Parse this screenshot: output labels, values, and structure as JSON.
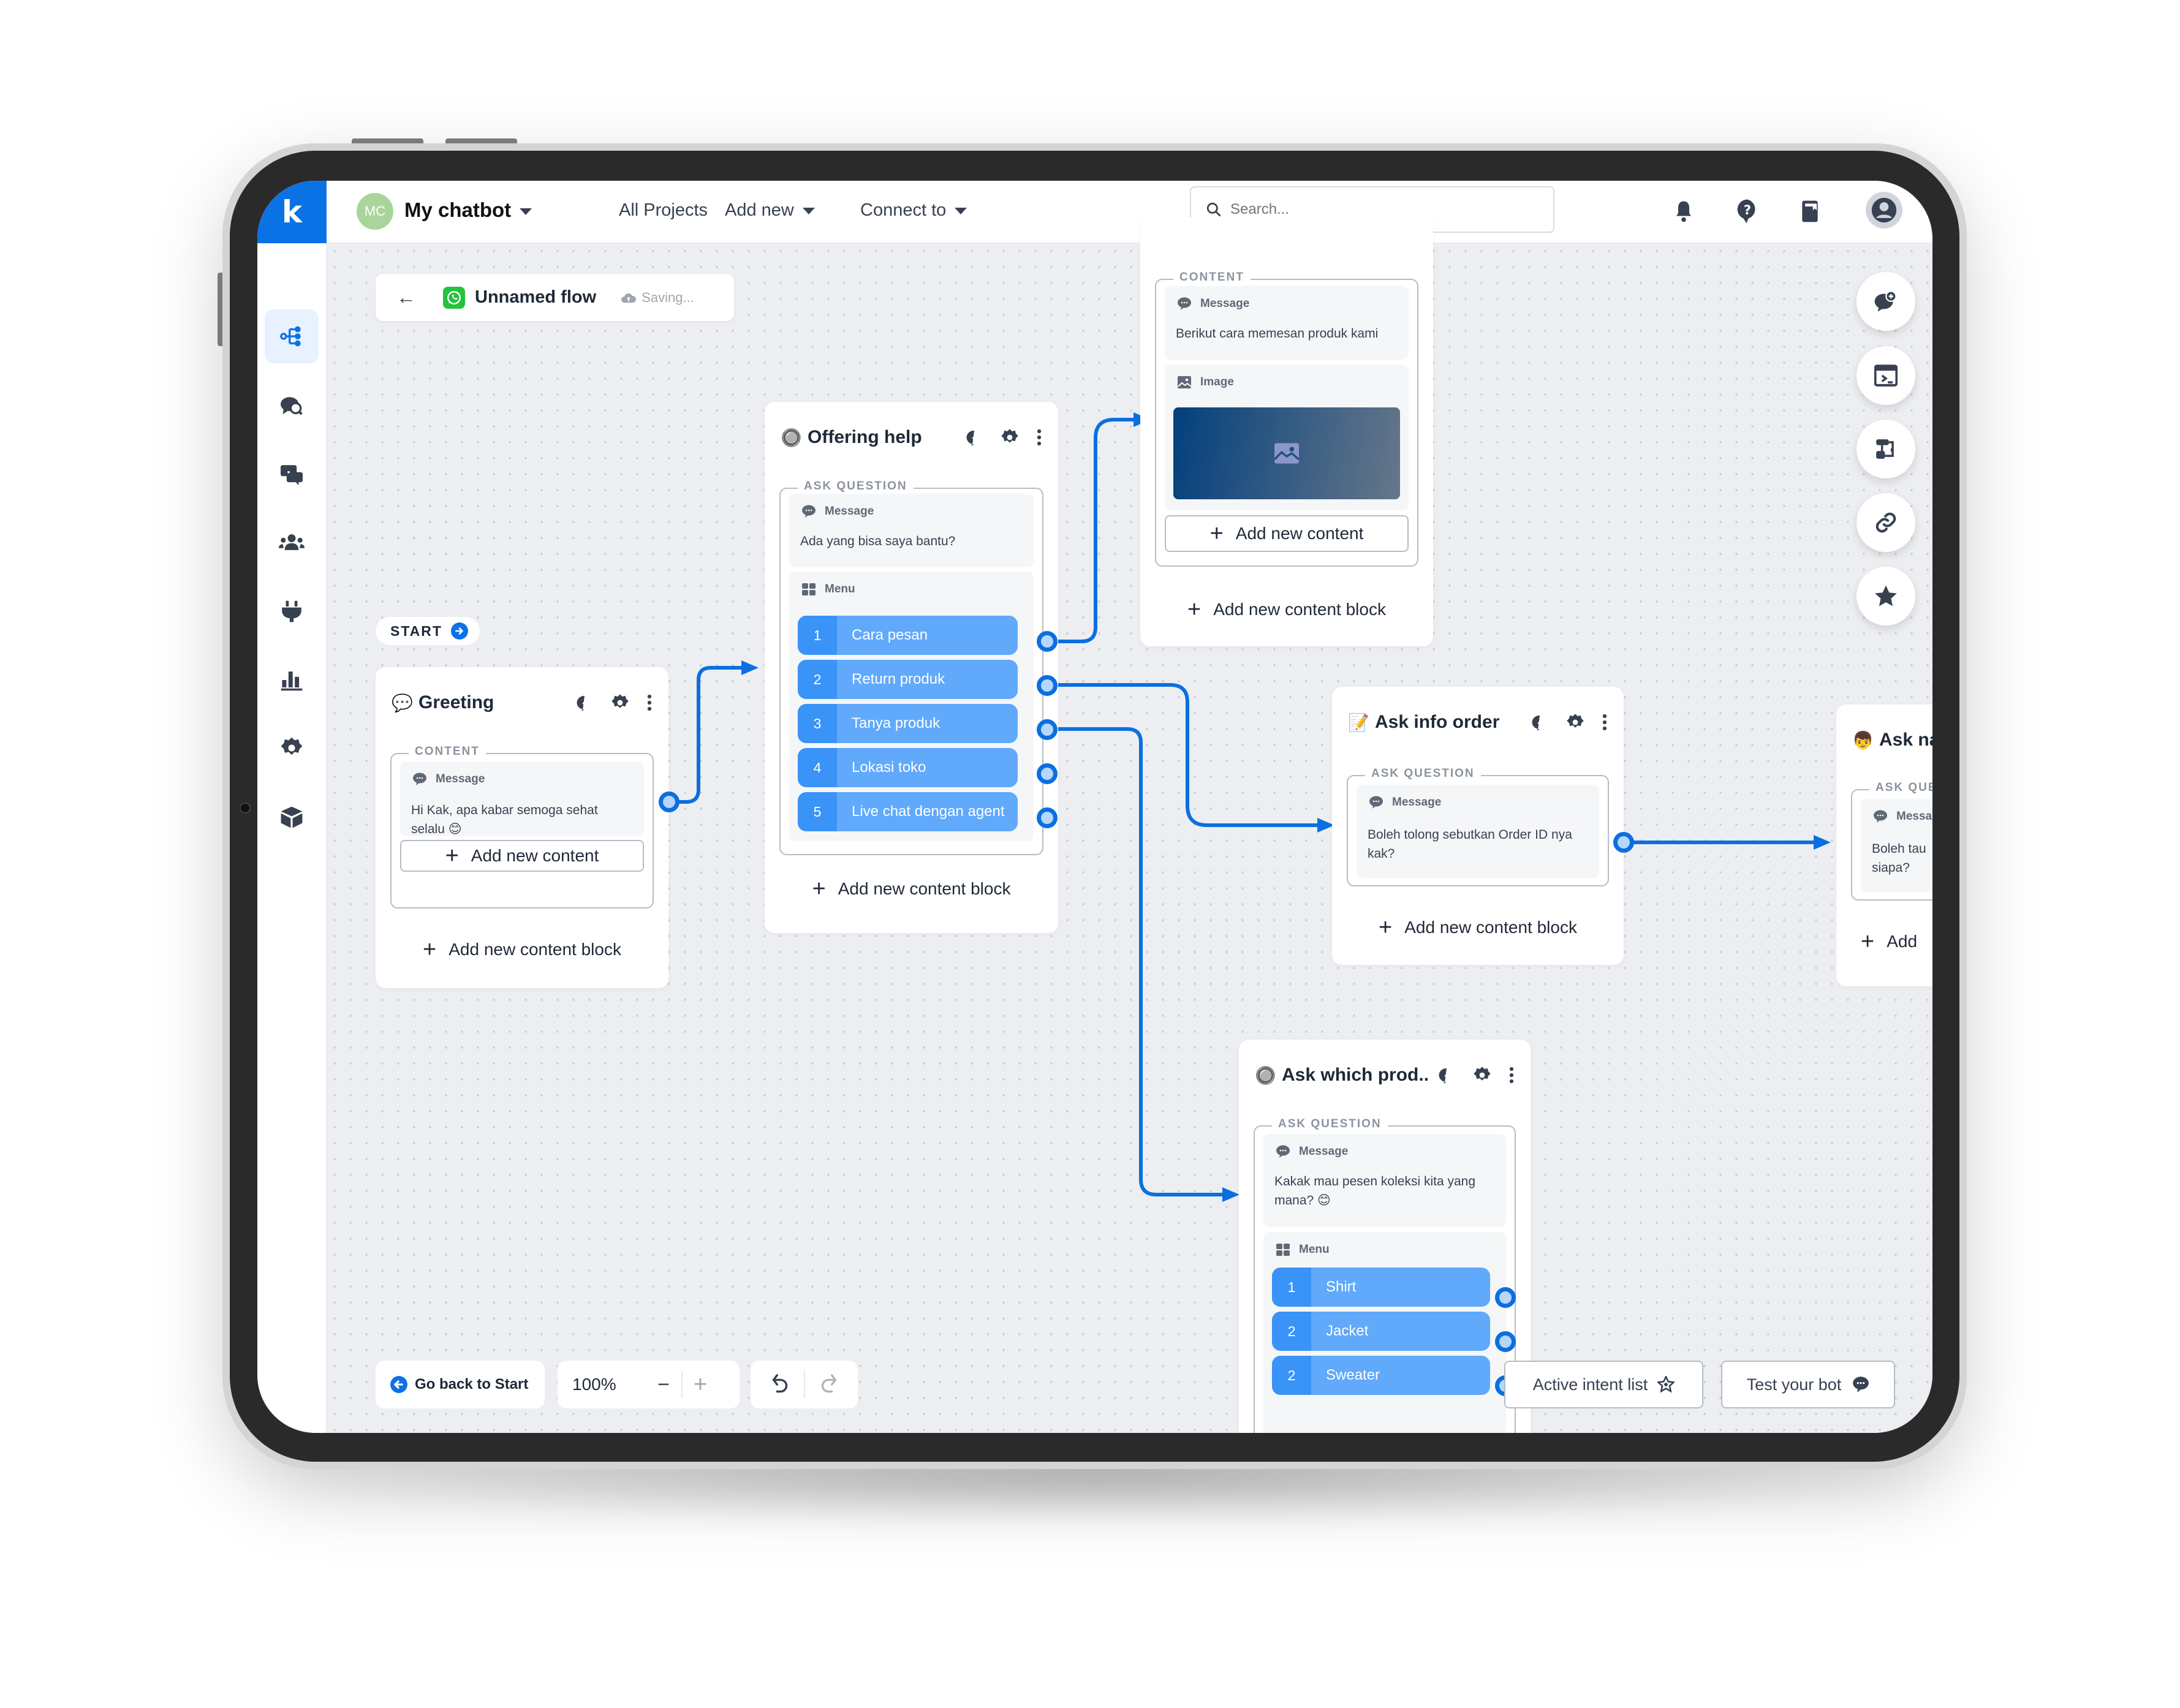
{
  "header": {
    "logo_glyph": "k",
    "bot_avatar_initials": "MC",
    "bot_name": "My chatbot",
    "nav": [
      {
        "label": "All Projects"
      },
      {
        "label": "Add new"
      },
      {
        "label": "Connect to"
      }
    ],
    "search": {
      "value": "",
      "placeholder": "Search..."
    },
    "icons": [
      "bell-icon",
      "help-icon",
      "book-icon",
      "user-avatar"
    ]
  },
  "sidebar": {
    "items": [
      {
        "icon": "flow-icon",
        "active": true
      },
      {
        "icon": "chat-search-icon",
        "active": false
      },
      {
        "icon": "conversations-icon",
        "active": false
      },
      {
        "icon": "users-icon",
        "active": false
      },
      {
        "icon": "plug-icon",
        "active": false
      },
      {
        "icon": "analytics-icon",
        "active": false
      },
      {
        "icon": "settings-icon",
        "active": false
      },
      {
        "icon": "box-icon",
        "active": false
      }
    ]
  },
  "flow": {
    "back_glyph": "←",
    "name": "Unnamed flow",
    "status": "Saving..."
  },
  "start_label": "START",
  "common": {
    "add_new_content": "Add new content",
    "add_new_content_block": "Add new content block",
    "message_label": "Message",
    "menu_label": "Menu",
    "image_label": "Image",
    "content_label": "CONTENT",
    "ask_question_label": "ASK QUESTION"
  },
  "nodes": {
    "greeting": {
      "emoji": "💬",
      "title": "Greeting",
      "section": "CONTENT",
      "message": "Hi Kak, apa kabar semoga sehat selalu 😊"
    },
    "offering_help": {
      "emoji": "🔘",
      "title": "Offering help",
      "section": "ASK QUESTION",
      "message": "Ada yang bisa saya bantu?",
      "menu": [
        {
          "num": "1",
          "label": "Cara pesan"
        },
        {
          "num": "2",
          "label": "Return produk"
        },
        {
          "num": "3",
          "label": "Tanya produk"
        },
        {
          "num": "4",
          "label": "Lokasi toko"
        },
        {
          "num": "5",
          "label": "Live chat dengan agent"
        }
      ]
    },
    "cara_pesan": {
      "section": "CONTENT",
      "message": "Berikut cara memesan produk kami",
      "image_label": "Image"
    },
    "ask_info_order": {
      "emoji": "📝",
      "title": "Ask info order",
      "section": "ASK QUESTION",
      "message": "Boleh tolong sebutkan Order ID nya kak?"
    },
    "ask_name": {
      "emoji": "👦",
      "title": "Ask na",
      "section": "ASK QUE",
      "message_label": "Messa",
      "message": "Boleh tau siapa?",
      "add_block": "Add"
    },
    "ask_which_product": {
      "emoji": "🔘",
      "title": "Ask which prod..",
      "section": "ASK QUESTION",
      "message": "Kakak mau pesen koleksi kita yang mana? 😊",
      "menu": [
        {
          "num": "1",
          "label": "Shirt"
        },
        {
          "num": "2",
          "label": "Jacket"
        },
        {
          "num": "2",
          "label": "Sweater"
        }
      ]
    }
  },
  "bottom_bar": {
    "go_back": "Go back to Start",
    "zoom_level": "100%",
    "zoom_out": "−",
    "zoom_in": "+",
    "active_intent_list": "Active intent list",
    "test_bot": "Test your bot"
  },
  "right_tools": [
    "add-chat-icon",
    "console-icon",
    "flowchart-icon",
    "link-icon",
    "star-icon"
  ],
  "colors": {
    "brand": "#0b72e6",
    "connector": "#0b6fe0",
    "menu_item": "#60a9fb",
    "menu_num": "#3a93f6",
    "canvas": "#eceef1"
  }
}
